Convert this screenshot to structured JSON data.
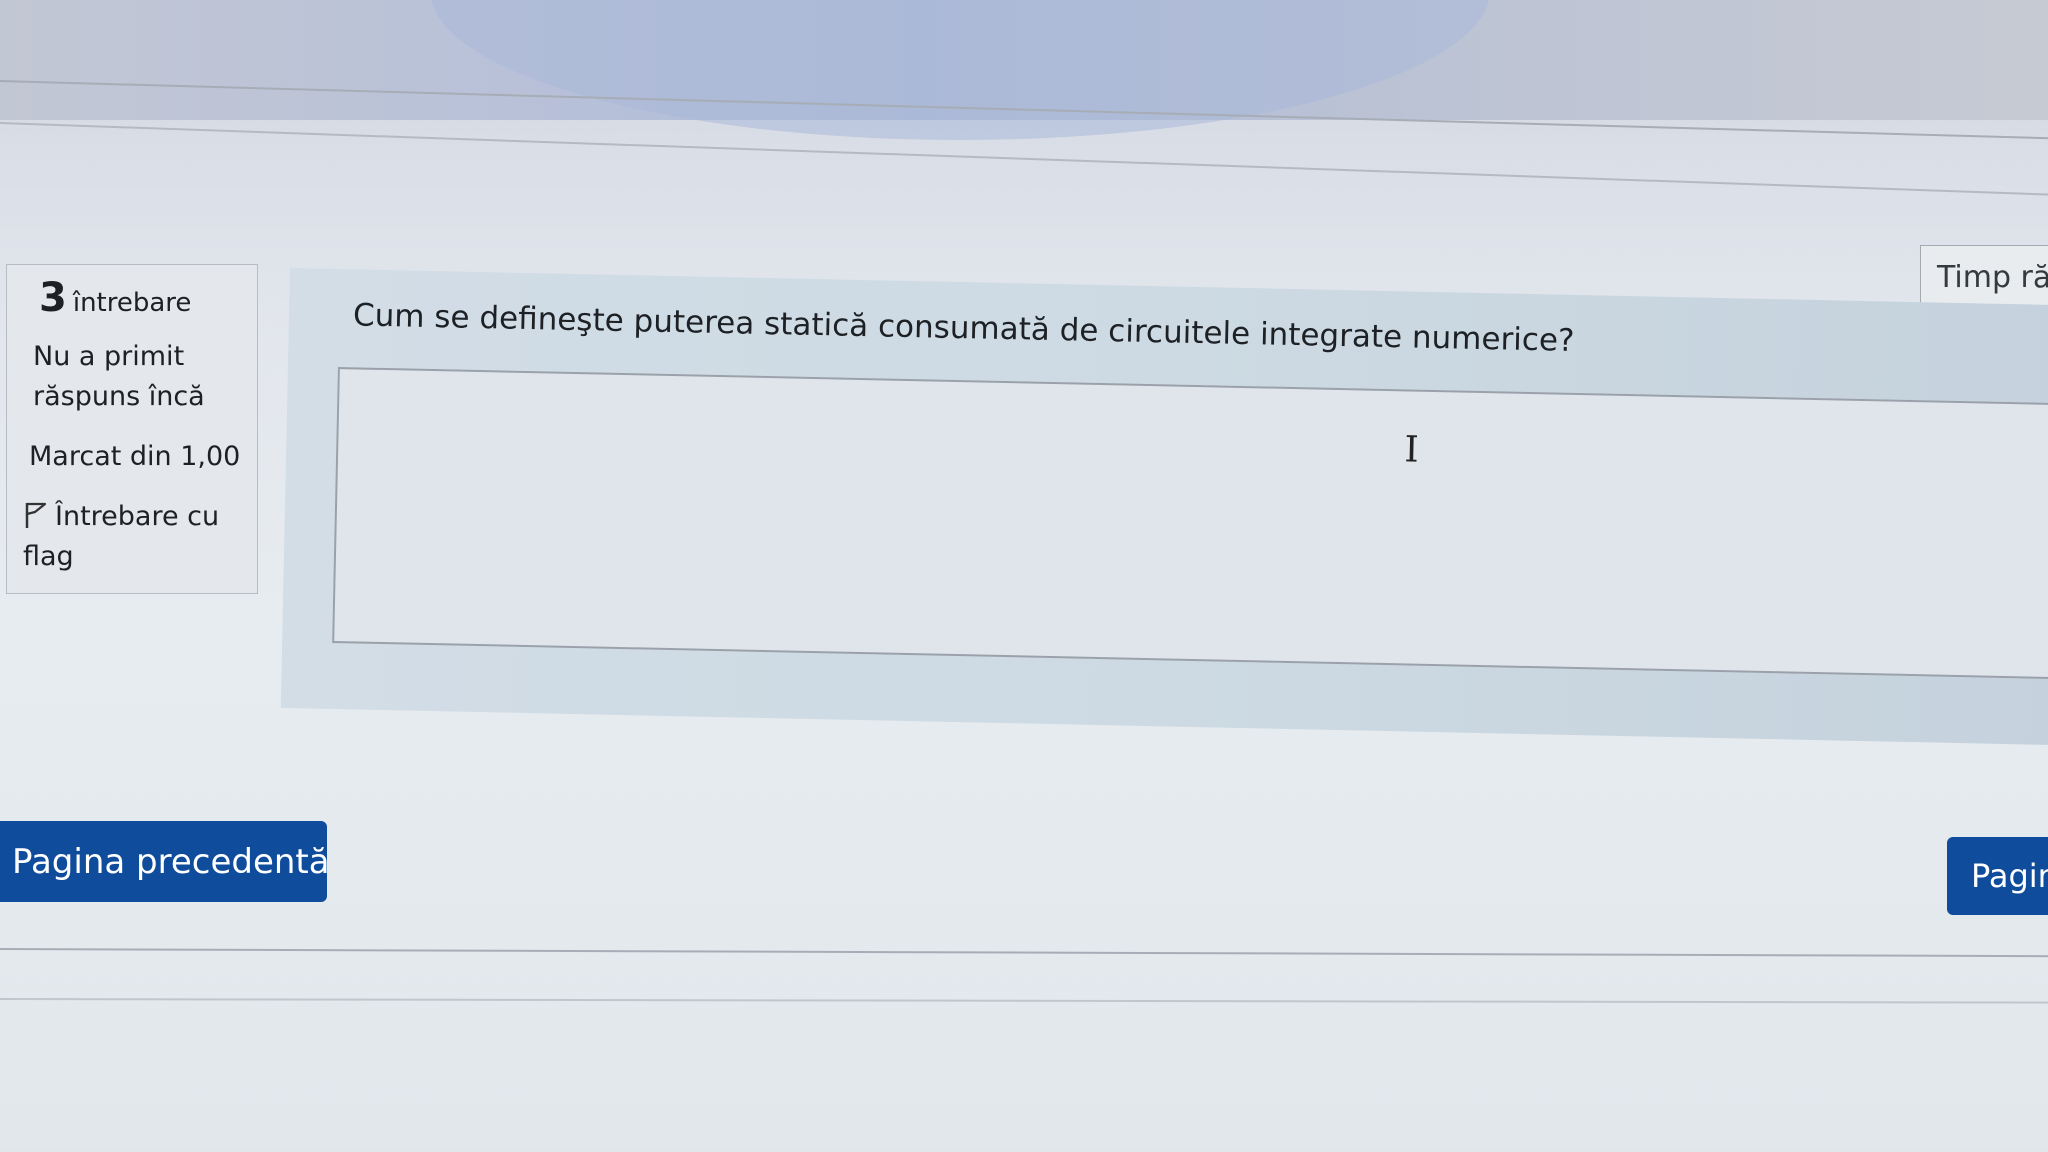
{
  "timer": {
    "label": "Timp răm"
  },
  "question_info": {
    "number": "3",
    "label": "întrebare",
    "state": "Nu a primit răspuns încă",
    "grade": "Marcat din 1,00",
    "flag_label": "Întrebare cu flag"
  },
  "question": {
    "text": "Cum se defineşte puterea statică consumată de circuitele integrate numerice?",
    "answer_value": ""
  },
  "navigation": {
    "prev_label": "Pagina precedentă",
    "next_label": "Pagin"
  },
  "colors": {
    "button_primary": "#0f4c9c",
    "panel_bg": "#cddae3"
  }
}
